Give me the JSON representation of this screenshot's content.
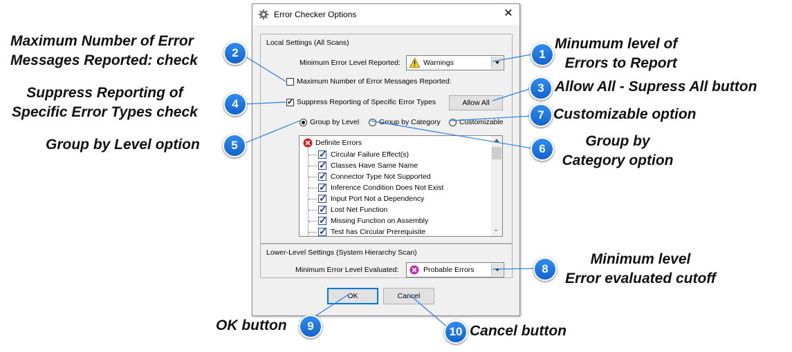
{
  "dialog": {
    "title": "Error Checker Options",
    "close_symbol": "✕",
    "local_group": {
      "label": "Local Settings (All Scans)",
      "min_level_label": "Minimum Error Level Reported:",
      "min_level_value": "Warnings",
      "min_level_icon": "warning-triangle-icon",
      "max_number_label": "Maximum Number of Error Messages Reported:",
      "max_number_checked": false,
      "suppress_label": "Suppress Reporting of Specific Error Types",
      "suppress_checked": true,
      "allow_all_label": "Allow All",
      "radios": [
        {
          "label": "Group by Level",
          "selected": true
        },
        {
          "label": "Group by Category",
          "selected": false
        },
        {
          "label": "Customizable",
          "selected": false
        }
      ],
      "tree": {
        "root": "Definite Errors",
        "root_icon": "red-error-icon",
        "items": [
          "Circular Failure Effect(s)",
          "Classes Have Same Name",
          "Connector Type Not Supported",
          "Inference Condition Does Not Exist",
          "Input Port Not a Dependency",
          "Lost Net Function",
          "Missing Function on Assembly",
          "Test has Circular Prerequisite"
        ]
      }
    },
    "lower_group": {
      "label": "Lower-Level Settings (System Hierarchy Scan)",
      "eval_label": "Minimum Error Level Evaluated:",
      "eval_value": "Probable Errors",
      "eval_icon": "magenta-error-icon"
    },
    "ok_label": "OK",
    "cancel_label": "Cancel"
  },
  "callouts": {
    "c1": {
      "num": "1",
      "line1": "Minumum level of",
      "line2": "Errors to Report"
    },
    "c2": {
      "num": "2",
      "line1": "Maximum Number of Error",
      "line2": "Messages Reported: check"
    },
    "c3": {
      "num": "3",
      "line1": "Allow All - Supress All button"
    },
    "c4": {
      "num": "4",
      "line1": "Suppress Reporting of",
      "line2": "Specific Error Types check"
    },
    "c5": {
      "num": "5",
      "line1": "Group by Level option"
    },
    "c6": {
      "num": "6",
      "line1": "Group by",
      "line2": "Category option"
    },
    "c7": {
      "num": "7",
      "line1": "Customizable option"
    },
    "c8": {
      "num": "8",
      "line1": "Minimum level",
      "line2": "Error evaluated cutoff"
    },
    "c9": {
      "num": "9",
      "line1": "OK button"
    },
    "c10": {
      "num": "10",
      "line1": "Cancel button"
    }
  },
  "colors": {
    "badge": "#1f78e6",
    "callout_line": "#2a7de1",
    "error_red": "#d32222",
    "probable_magenta": "#c42ab5",
    "warning_yellow": "#f5d90f"
  }
}
